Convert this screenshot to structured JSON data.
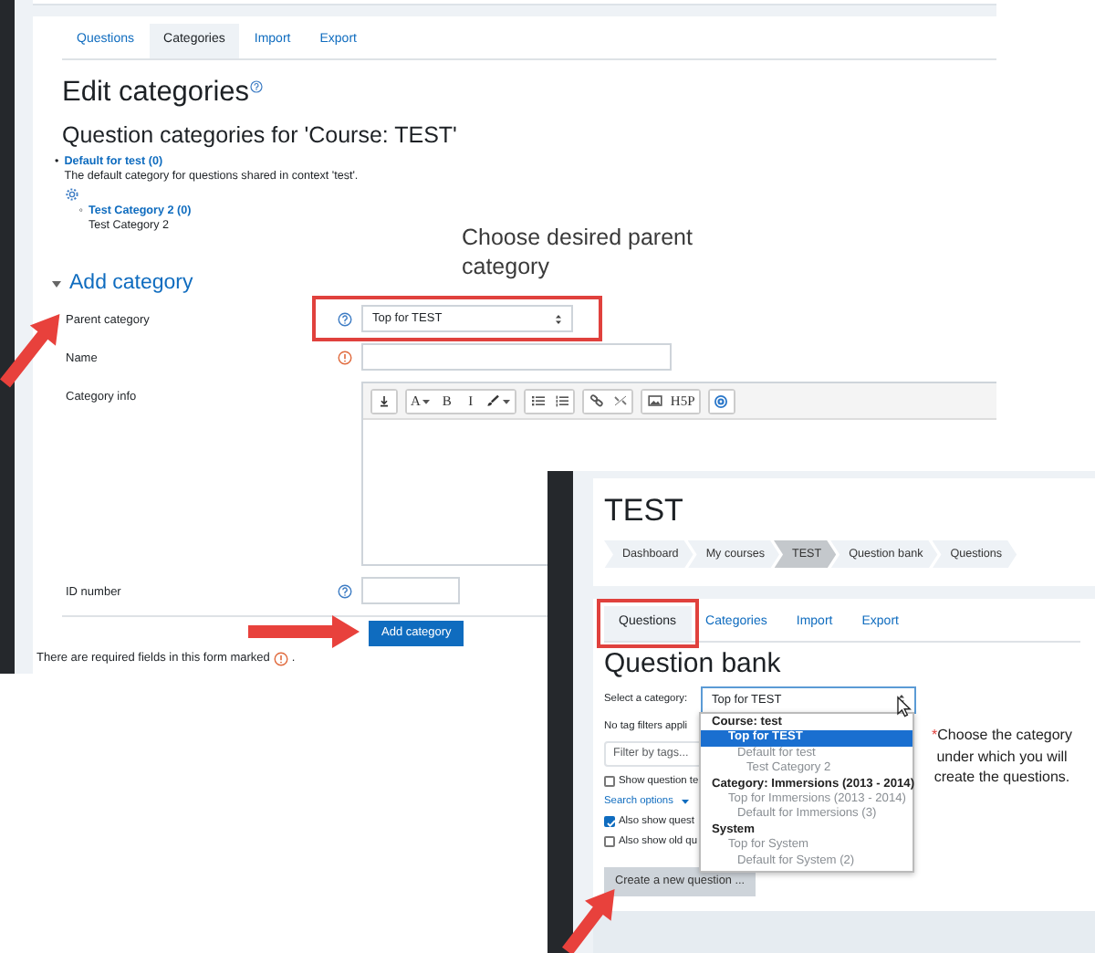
{
  "back_screen": {
    "tabs": [
      {
        "label": "Questions",
        "selected": false
      },
      {
        "label": "Categories",
        "selected": true
      },
      {
        "label": "Import",
        "selected": false
      },
      {
        "label": "Export",
        "selected": false
      }
    ],
    "title": "Edit categories",
    "subtitle": "Question categories for 'Course: TEST'",
    "categories": [
      {
        "marker": "•",
        "name": "Default for test (0)",
        "description": "The default category for questions shared in context 'test'.",
        "children": [
          {
            "marker": "◦",
            "name": "Test Category 2 (0)",
            "description": "Test Category 2"
          }
        ]
      }
    ],
    "section": {
      "title": "Add category",
      "expanded": true
    },
    "fields": [
      {
        "label": "Parent category",
        "kind": "select",
        "help": true,
        "required": false,
        "value": "Top for TEST",
        "highlighted": true
      },
      {
        "label": "Name",
        "kind": "text",
        "help": false,
        "required": true,
        "highlighted": false
      },
      {
        "label": "Category info",
        "kind": "editor",
        "help": false,
        "required": false,
        "highlighted": false
      },
      {
        "label": "ID number",
        "kind": "short",
        "help": true,
        "required": false,
        "highlighted": false
      }
    ],
    "editor_toolbar": [
      [
        {
          "kind": "icon"
        }
      ],
      [
        {
          "kind": "text",
          "label": "A",
          "caret": true
        },
        {
          "kind": "text",
          "label": "B"
        },
        {
          "kind": "text",
          "label": "I"
        },
        {
          "kind": "icon",
          "caret": true
        }
      ],
      [
        {
          "kind": "icon"
        },
        {
          "kind": "icon"
        }
      ],
      [
        {
          "kind": "icon"
        },
        {
          "kind": "icon"
        }
      ],
      [
        {
          "kind": "icon"
        },
        {
          "kind": "text",
          "label": "H5P"
        }
      ],
      [
        {
          "kind": "icon"
        }
      ]
    ],
    "submit": "Add category",
    "required_note": "There are required fields in this form marked",
    "required_note_end": "."
  },
  "front_screen": {
    "title": "TEST",
    "breadcrumb": [
      {
        "label": "Dashboard",
        "selected": false
      },
      {
        "label": "My courses",
        "selected": false
      },
      {
        "label": "TEST",
        "selected": true
      },
      {
        "label": "Question bank",
        "selected": false
      },
      {
        "label": "Questions",
        "selected": false
      }
    ],
    "tabs": [
      {
        "label": "Questions",
        "selected": true,
        "highlighted": true
      },
      {
        "label": "Categories",
        "selected": false,
        "highlighted": false
      },
      {
        "label": "Import",
        "selected": false,
        "highlighted": false
      },
      {
        "label": "Export",
        "selected": false,
        "highlighted": false
      }
    ],
    "heading": "Question bank",
    "category_label": "Select a category:",
    "category_value": "Top for TEST",
    "dropdown": [
      {
        "label": "Course: test",
        "children": [
          {
            "label": "Top for TEST",
            "selected": true,
            "children": [
              {
                "label": "Default for test",
                "selected": false,
                "children": [
                  {
                    "label": "Test Category 2",
                    "selected": false
                  }
                ]
              }
            ]
          }
        ]
      },
      {
        "label": "Category: Immersions (2013 - 2014)",
        "children": [
          {
            "label": "Top for Immersions (2013 - 2014)",
            "selected": false,
            "children": [
              {
                "label": "Default for Immersions (3)",
                "selected": false
              }
            ]
          }
        ]
      },
      {
        "label": "System",
        "children": [
          {
            "label": "Top for System",
            "selected": false,
            "children": [
              {
                "label": "Default for System (2)",
                "selected": false
              }
            ]
          }
        ]
      }
    ],
    "tag_note": "No tag filters appli",
    "filter_placeholder": "Filter by tags...",
    "options": [
      {
        "kind": "checkbox",
        "label": "Show question te",
        "checked": false
      },
      {
        "kind": "link",
        "label": "Search options"
      },
      {
        "kind": "checkbox",
        "label": "Also show quest",
        "checked": true
      },
      {
        "kind": "checkbox",
        "label": "Also show old qu",
        "checked": false
      }
    ],
    "create_button": "Create a new question ..."
  },
  "annotations": [
    {
      "text": "Choose desired parent category"
    },
    {
      "mark": "*",
      "text": "Choose the category under which you will create the questions."
    }
  ]
}
